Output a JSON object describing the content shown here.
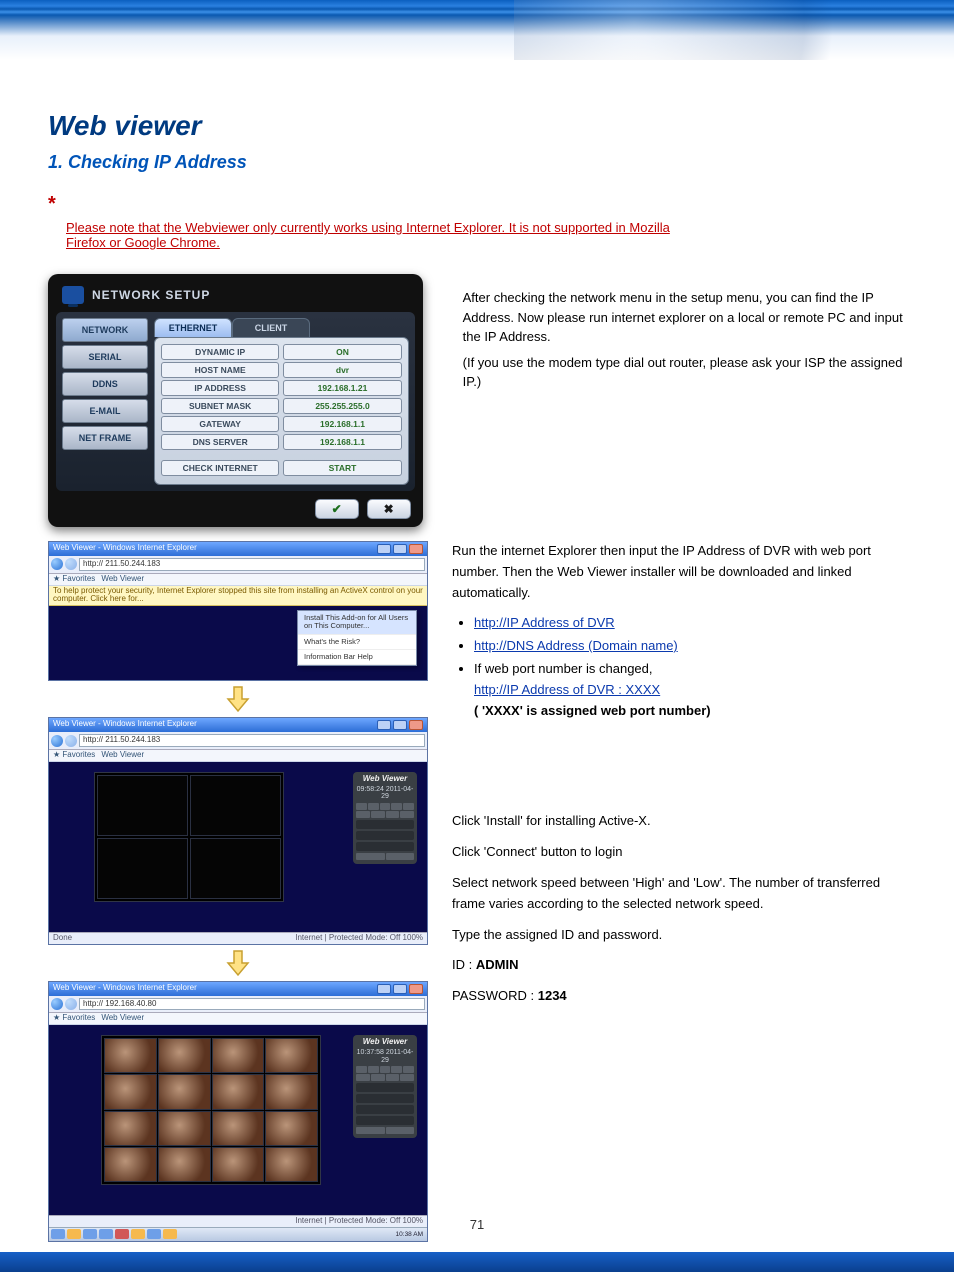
{
  "header": {
    "section_title": "Web viewer",
    "subtitle": "1.  Checking IP Address"
  },
  "note": {
    "star": "*",
    "line1": "Please note that the Webviewer only currently works using Internet Explorer. It is not supported in Mozilla",
    "line2": "Firefox or Google Chrome."
  },
  "dvr": {
    "title": "NETWORK SETUP",
    "tabs": {
      "network": "NETWORK",
      "serial": "SERIAL",
      "ddns": "DDNS",
      "email": "E-MAIL",
      "netframe": "NET FRAME"
    },
    "subtabs": {
      "ethernet": "ETHERNET",
      "client": "CLIENT"
    },
    "rows": {
      "dynamic_label": "DYNAMIC IP",
      "dynamic_val": "ON",
      "host_label": "HOST NAME",
      "host_val": "dvr",
      "ip_label": "IP ADDRESS",
      "ip_val": "192.168.1.21",
      "subnet_label": "SUBNET MASK",
      "subnet_val": "255.255.255.0",
      "gateway_label": "GATEWAY",
      "gateway_val": "192.168.1.1",
      "dns_label": "DNS SERVER",
      "dns_val": "192.168.1.1",
      "check_label": "CHECK INTERNET",
      "check_val": "START"
    },
    "ok": "✔",
    "cancel": "✖"
  },
  "fig1_caption": "After checking the network menu in the setup menu, you can find the IP Address. Now please run internet explorer on a local or remote PC and input the IP Address.",
  "fig1_caption2": "(If you use the modem type dial out router, please ask your ISP the assigned IP.)",
  "ie1": {
    "title": "Web Viewer - Windows Internet Explorer",
    "addr": "http://  211.50.244.183",
    "fav": "Favorites",
    "fav2": "Web Viewer",
    "yellow": "To help protect your security, Internet Explorer stopped this site from installing an ActiveX control on your computer. Click here for...",
    "ctx1": "Install This Add-on for All Users on This Computer...",
    "ctx2": "What's the Risk?",
    "ctx3": "Information Bar Help"
  },
  "right": {
    "para1": "Run the internet Explorer then input the IP Address of DVR with web port number. Then the Web Viewer installer will be downloaded and linked automatically.",
    "bullet1": "http://IP Address of DVR",
    "bullet2": "http://DNS Address (Domain name)",
    "para_if": "If web port number is changed,",
    "bullet3": "http://IP Address of DVR : XXXX",
    "tail": "( 'XXXX' is assigned web port number)",
    "para2": "Click 'Install' for installing Active-X.",
    "para3": "Click 'Connect' button to login",
    "para4": "Select network speed between 'High' and 'Low'. The number of transferred frame varies according to the selected network speed.",
    "para5": "Type the assigned ID and password.",
    "id_label": "ID  :",
    "id_val": "ADMIN",
    "pw_label": "PASSWORD  :",
    "pw_val": "1234"
  },
  "ie2": {
    "title": "Web Viewer - Windows Internet Explorer",
    "addr": "http://  211.50.244.183",
    "fav": "Favorites",
    "fav2": "Web Viewer",
    "wv_title": "Web Viewer",
    "wv_time": "09:58:24  2011-04-29",
    "status_left": "Done",
    "status_right": "Internet | Protected Mode: Off        100%"
  },
  "ie3": {
    "title": "Web Viewer - Windows Internet Explorer",
    "addr": "http://  192.168.40.80",
    "fav": "Favorites",
    "fav2": "Web Viewer",
    "wv_title": "Web Viewer",
    "wv_time": "10:37:58  2011-04-29",
    "status_right": "Internet | Protected Mode: Off        100%",
    "task_time": "10:38 AM"
  },
  "page_number": "71"
}
